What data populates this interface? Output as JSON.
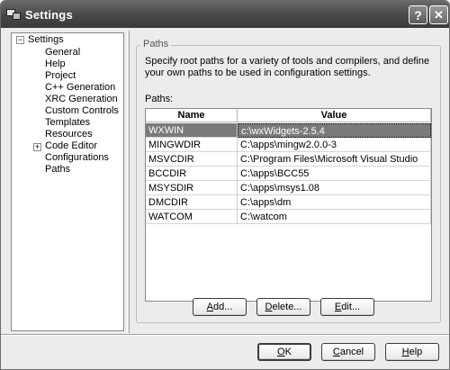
{
  "window": {
    "title": "Settings",
    "help_label": "?",
    "close_label": "✕"
  },
  "tree": {
    "root": "Settings",
    "items": [
      {
        "label": "General"
      },
      {
        "label": "Help"
      },
      {
        "label": "Project"
      },
      {
        "label": "C++ Generation"
      },
      {
        "label": "XRC Generation"
      },
      {
        "label": "Custom Controls"
      },
      {
        "label": "Templates"
      },
      {
        "label": "Resources"
      },
      {
        "label": "Code Editor"
      },
      {
        "label": "Configurations"
      },
      {
        "label": "Paths"
      }
    ],
    "selected": "Paths"
  },
  "panel": {
    "group_label": "Paths",
    "description": "Specify root paths for a variety of tools and compilers, and define your own paths to be used in configuration settings.",
    "list_label": "Paths:"
  },
  "table": {
    "columns": [
      "Name",
      "Value"
    ],
    "rows": [
      {
        "name": "WXWIN",
        "value": "c:\\wxWidgets-2.5.4"
      },
      {
        "name": "MINGWDIR",
        "value": "C:\\apps\\mingw2.0.0-3"
      },
      {
        "name": "MSVCDIR",
        "value": "C:\\Program Files\\Microsoft Visual Studio"
      },
      {
        "name": "BCCDIR",
        "value": "C:\\apps\\BCC55"
      },
      {
        "name": "MSYSDIR",
        "value": "C:\\apps\\msys1.08"
      },
      {
        "name": "DMCDIR",
        "value": "C:\\apps\\dm"
      },
      {
        "name": "WATCOM",
        "value": "C:\\watcom"
      }
    ],
    "selected_row": 0
  },
  "buttons": {
    "add": {
      "pre": "",
      "key": "A",
      "post": "dd..."
    },
    "delete": {
      "pre": "",
      "key": "D",
      "post": "elete..."
    },
    "edit": {
      "pre": "",
      "key": "E",
      "post": "dit..."
    },
    "ok": {
      "pre": "",
      "key": "O",
      "post": "K"
    },
    "cancel": {
      "pre": "",
      "key": "C",
      "post": "ancel"
    },
    "help": {
      "pre": "",
      "key": "H",
      "post": "elp"
    }
  },
  "colors": {
    "selection": "#7a7a7a",
    "titlebar": "#474747"
  },
  "icons": {
    "app": "settings-app-icon",
    "expand": "tree-collapse-icon",
    "collapsed": "tree-expand-icon"
  }
}
